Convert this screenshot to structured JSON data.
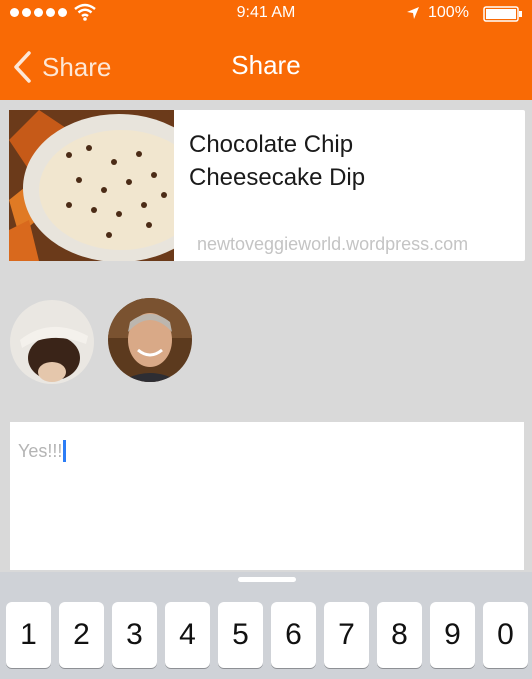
{
  "status_bar": {
    "time": "9:41 AM",
    "battery": "100%",
    "icons": [
      "signal-dots-icon",
      "wifi-icon",
      "location-arrow-icon",
      "battery-icon"
    ]
  },
  "nav": {
    "back_label": "Share",
    "title": "Share",
    "back_icon": "chevron-left-icon"
  },
  "shared_item": {
    "title_line1": "Chocolate Chip",
    "title_line2": "Cheesecake Dip",
    "source": "newtoveggieworld.wordpress.com",
    "thumbnail": "dip-bowl-photo"
  },
  "recipients": [
    {
      "avatar": "user-avatar-hat"
    },
    {
      "avatar": "user-avatar-man"
    }
  ],
  "compose": {
    "text": "Yes!!!"
  },
  "keyboard": {
    "keys": [
      "1",
      "2",
      "3",
      "4",
      "5",
      "6",
      "7",
      "8",
      "9",
      "0"
    ]
  },
  "colors": {
    "accent": "#f96a05",
    "background": "#d9d9d9",
    "url_text": "#c4c4c4",
    "caret": "#2c7df6"
  }
}
